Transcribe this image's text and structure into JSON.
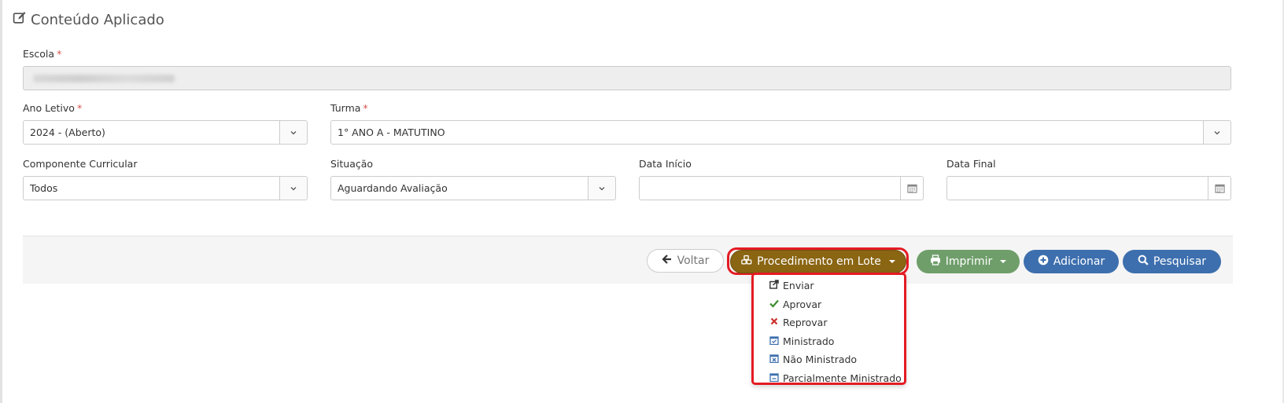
{
  "page": {
    "title": "Conteúdo Aplicado"
  },
  "form": {
    "escola": {
      "label": "Escola",
      "required_mark": "*"
    },
    "ano_letivo": {
      "label": "Ano Letivo",
      "required_mark": "*",
      "value": "2024 - (Aberto)"
    },
    "turma": {
      "label": "Turma",
      "required_mark": "*",
      "value": "1° ANO A - MATUTINO"
    },
    "componente": {
      "label": "Componente Curricular",
      "value": "Todos"
    },
    "situacao": {
      "label": "Situação",
      "value": "Aguardando Avaliação"
    },
    "data_inicio": {
      "label": "Data Início",
      "value": ""
    },
    "data_final": {
      "label": "Data Final",
      "value": ""
    }
  },
  "toolbar": {
    "back_label": "Voltar",
    "batch_label": "Procedimento em Lote",
    "print_label": "Imprimir",
    "add_label": "Adicionar",
    "search_label": "Pesquisar"
  },
  "batch_menu": {
    "items": [
      {
        "label": "Enviar",
        "icon": "share-icon"
      },
      {
        "label": "Aprovar",
        "icon": "check-icon"
      },
      {
        "label": "Reprovar",
        "icon": "times-icon"
      },
      {
        "label": "Ministrado",
        "icon": "calendar-check-icon"
      },
      {
        "label": "Não Ministrado",
        "icon": "calendar-times-icon"
      },
      {
        "label": "Parcialmente Ministrado",
        "icon": "calendar-minus-icon"
      }
    ]
  },
  "colors": {
    "batch_button": "#8a6512",
    "print_button": "#6f9e6a",
    "primary_button": "#3d6fae",
    "highlight": "#e41b23",
    "required": "#d9534f"
  }
}
